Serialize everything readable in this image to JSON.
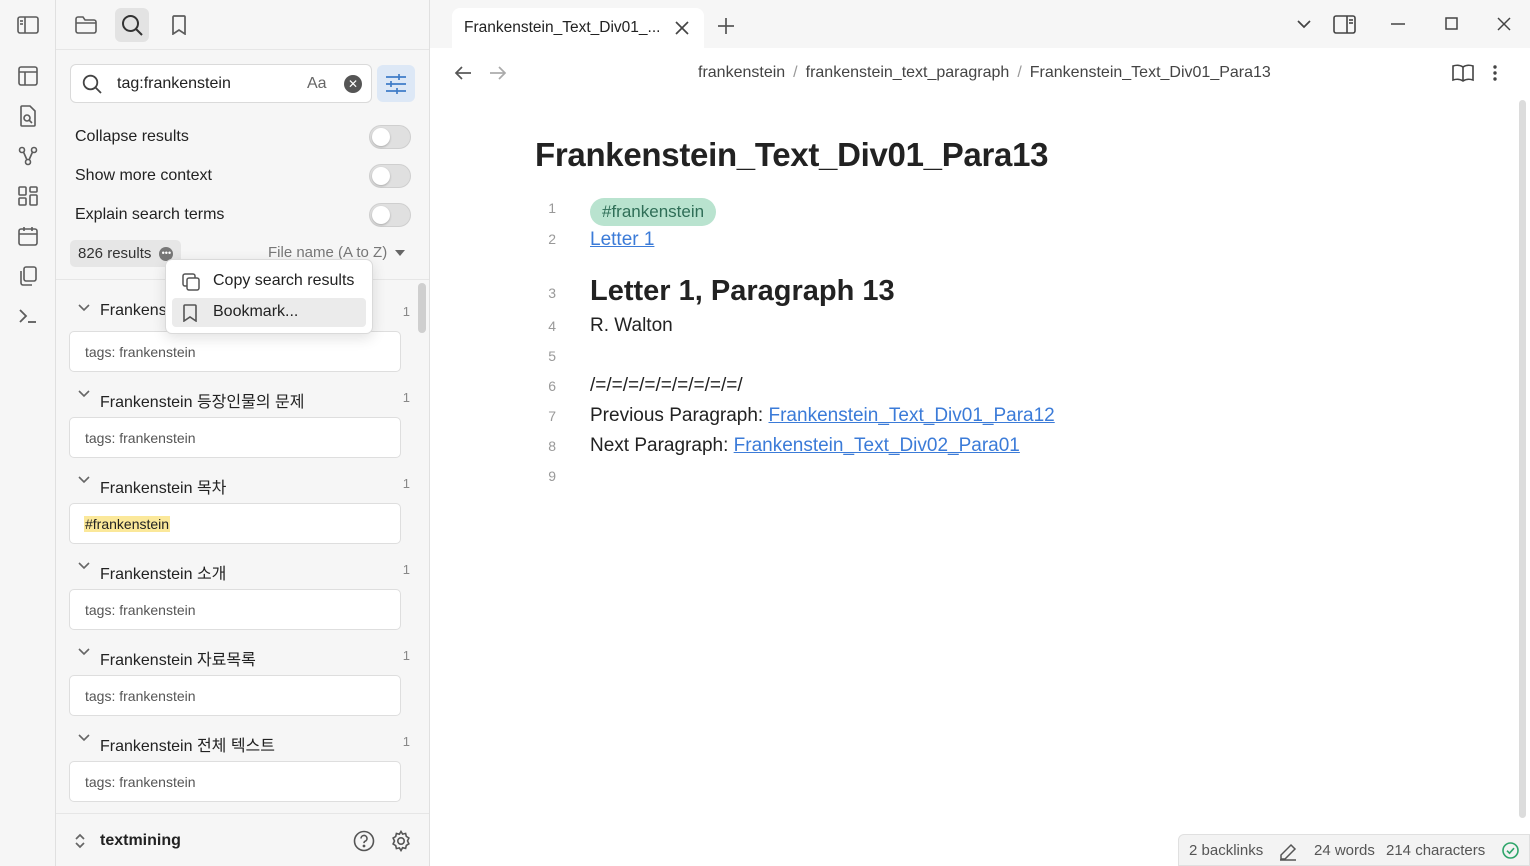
{
  "sidebar": {
    "search": {
      "query": "tag:frankenstein",
      "match_case": "Aa"
    },
    "options": [
      {
        "label": "Collapse results",
        "enabled": false
      },
      {
        "label": "Show more context",
        "enabled": false
      },
      {
        "label": "Explain search terms",
        "enabled": false
      }
    ],
    "results_count": "826 results",
    "sort": "File name (A to Z)",
    "results": [
      {
        "title": "Frankenstein",
        "count": "1",
        "snippet": "tags: frankenstein",
        "highlight": false
      },
      {
        "title": "Frankenstein 등장인물의 문제",
        "count": "1",
        "snippet": "tags: frankenstein",
        "highlight": false
      },
      {
        "title": "Frankenstein 목차",
        "count": "1",
        "snippet": "#frankenstein",
        "highlight": true
      },
      {
        "title": "Frankenstein 소개",
        "count": "1",
        "snippet": "tags: frankenstein",
        "highlight": false
      },
      {
        "title": "Frankenstein 자료목록",
        "count": "1",
        "snippet": "tags: frankenstein",
        "highlight": false
      },
      {
        "title": "Frankenstein 전체 텍스트",
        "count": "1",
        "snippet": "tags: frankenstein",
        "highlight": false
      }
    ],
    "vault_name": "textmining"
  },
  "context_menu": {
    "items": [
      {
        "label": "Copy search results",
        "icon": "copy-icon"
      },
      {
        "label": "Bookmark...",
        "icon": "bookmark-icon"
      }
    ]
  },
  "tab": {
    "title": "Frankenstein_Text_Div01_..."
  },
  "breadcrumb": [
    "frankenstein",
    "frankenstein_text_paragraph",
    "Frankenstein_Text_Div01_Para13"
  ],
  "note": {
    "title": "Frankenstein_Text_Div01_Para13",
    "line_numbers": [
      "1",
      "2",
      "3",
      "4",
      "5",
      "6",
      "7",
      "8",
      "9"
    ],
    "tag": "#frankenstein",
    "link_line": "Letter 1",
    "heading": "Letter 1, Paragraph 13",
    "author": "R. Walton",
    "separator": "/=/=/=/=/=/=/=/=/=/",
    "prev_label": "Previous Paragraph: ",
    "prev_link": "Frankenstein_Text_Div01_Para12",
    "next_label": "Next Paragraph: ",
    "next_link": "Frankenstein_Text_Div02_Para01"
  },
  "status": {
    "backlinks": "2 backlinks",
    "words": "24 words",
    "characters": "214 characters"
  },
  "colors": {
    "accent": "#3b7bd8",
    "tag_bg": "#b9e3cf",
    "tag_text": "#2f6e57",
    "highlight": "#fbe89a",
    "ok": "#2ea56a"
  }
}
